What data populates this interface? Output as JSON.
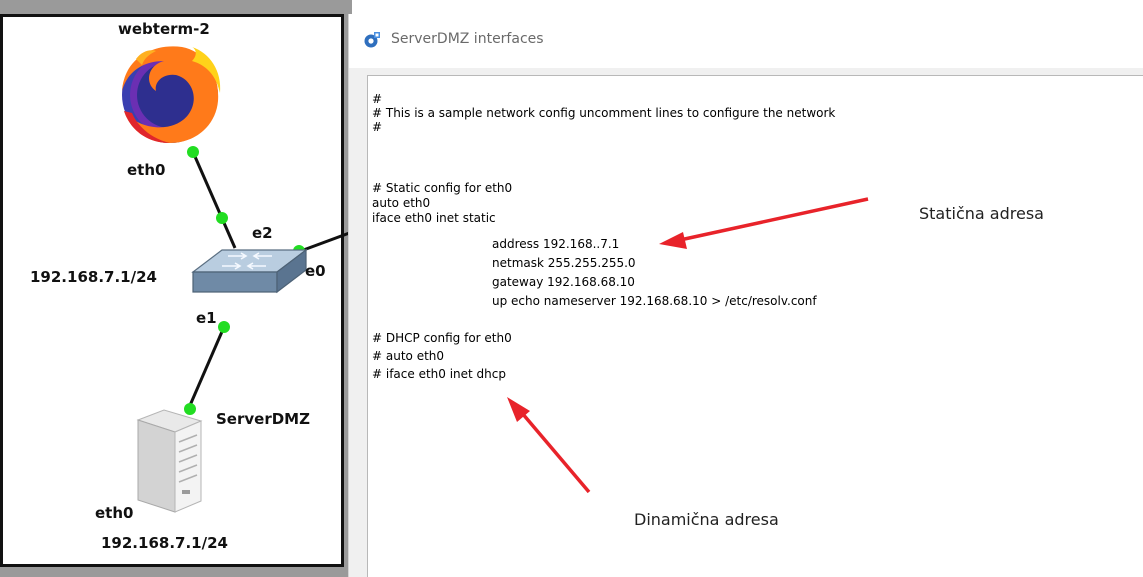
{
  "topology": {
    "webterm_name": "webterm-2",
    "webterm_port": "eth0",
    "switch_port_e2": "e2",
    "switch_port_e0": "e0",
    "switch_port_e1": "e1",
    "switch_subnet": "192.168.7.1/24",
    "server_name": "ServerDMZ",
    "server_port": "eth0",
    "server_ip": "192.168.7.1/24",
    "link_endpoint_color": "#22dd22",
    "icons": {
      "webterm": "firefox-icon",
      "switch": "ethernet-switch-icon",
      "server": "server-tower-icon"
    }
  },
  "dialog": {
    "title": "ServerDMZ interfaces",
    "icon": "gns3-app-icon",
    "config_lines": {
      "l01": "#",
      "l02": "# This is a sample network config uncomment lines to configure the network",
      "l03": "#",
      "l04": "# Static config for eth0",
      "l05": "auto eth0",
      "l06": "iface eth0 inet static",
      "l07": "address 192.168..7.1",
      "l08": "netmask 255.255.255.0",
      "l09": "gateway 192.168.68.10",
      "l10": "up echo nameserver 192.168.68.10 > /etc/resolv.conf",
      "l11": "# DHCP config for eth0",
      "l12": "# auto eth0",
      "l13": "# iface eth0 inet dhcp"
    }
  },
  "annotations": {
    "static_label": "Statična adresa",
    "dynamic_label": "Dinamična adresa",
    "arrow_color": "#e8232a"
  }
}
